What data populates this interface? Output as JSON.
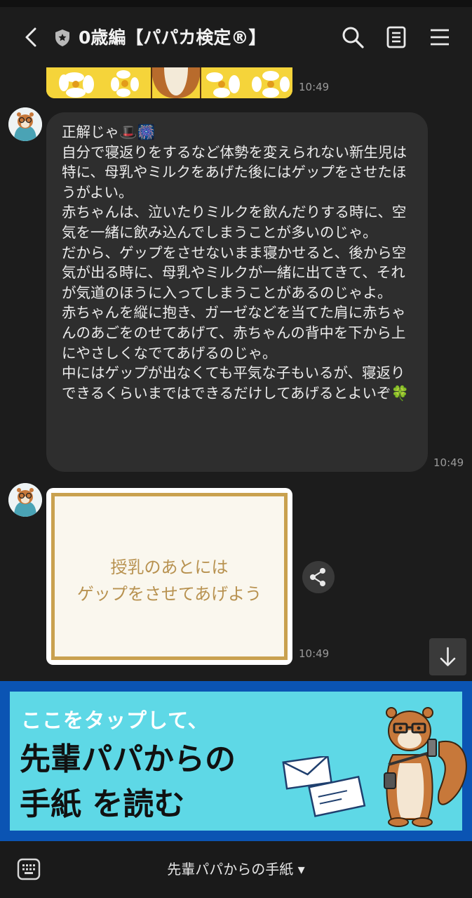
{
  "header": {
    "title": "0歳編【パパカ検定®】",
    "icons": [
      "back-icon",
      "shield-icon",
      "search-icon",
      "notes-icon",
      "menu-icon"
    ]
  },
  "messages": [
    {
      "type": "image",
      "time": "10:49"
    },
    {
      "type": "text",
      "text": "正解じゃ🎩🎆\n自分で寝返りをするなど体勢を変えられない新生児は特に、母乳やミルクをあげた後にはゲップをさせたほうがよい。\n赤ちゃんは、泣いたりミルクを飲んだりする時に、空気を一緒に飲み込んでしまうことが多いのじゃ。\nだから、ゲップをさせないまま寝かせると、後から空気が出る時に、母乳やミルクが一緒に出てきて、それが気道のほうに入ってしまうことがあるのじゃよ。\n赤ちゃんを縦に抱き、ガーゼなどを当てた肩に赤ちゃんのあごをのせてあげて、赤ちゃんの背中を下から上にやさしくなでてあげるのじゃ。\n中にはゲップが出なくても平気な子もいるが、寝返りできるくらいまではできるだけしてあげるとよいぞ🍀",
      "time": "10:49"
    },
    {
      "type": "card",
      "text": "授乳のあとには\nゲップをさせてあげよう",
      "time": "10:49"
    }
  ],
  "banner": {
    "subtitle": "ここをタップして、",
    "line1": "先輩パパからの",
    "line2": "手紙 を読む",
    "colors": {
      "frame": "#0b54b3",
      "fill": "#5ed8e6"
    }
  },
  "bottom_menu": {
    "label": "先輩パパからの手紙 ▾"
  }
}
